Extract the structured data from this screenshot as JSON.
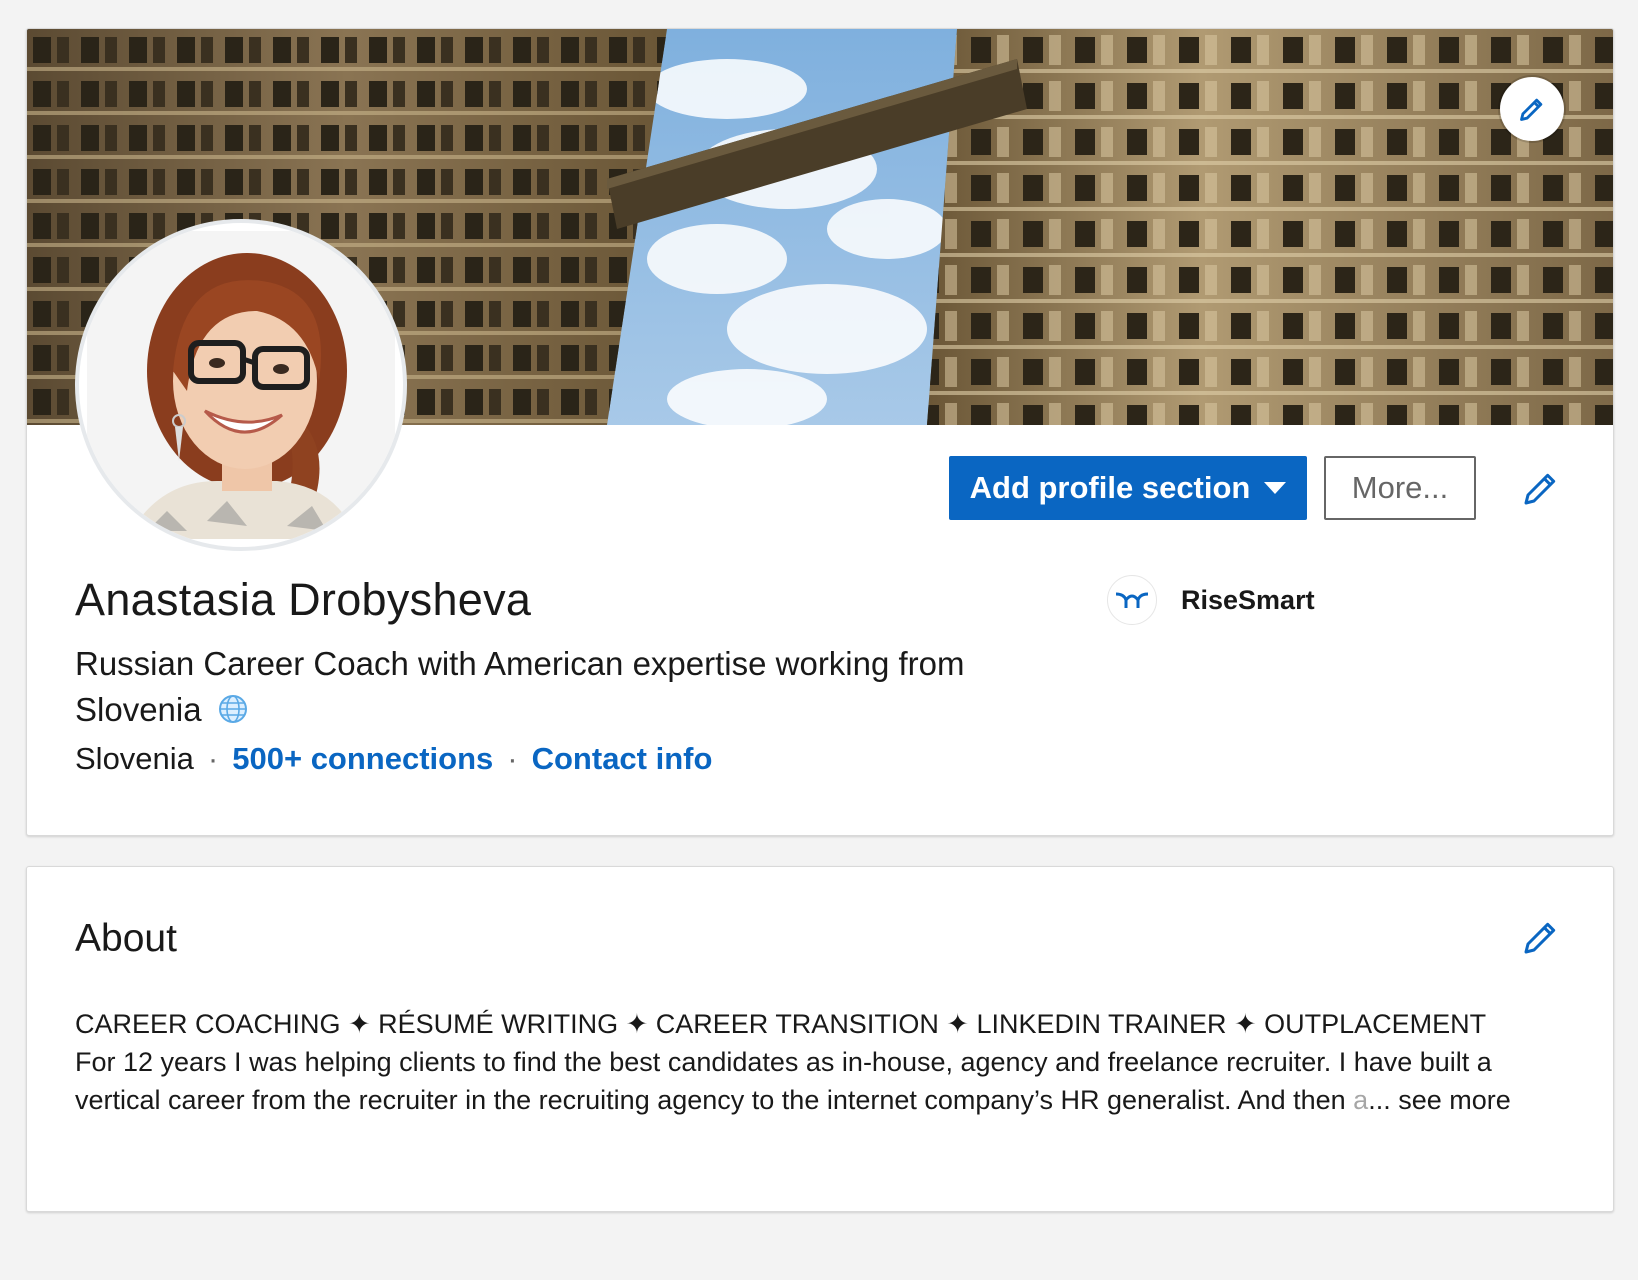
{
  "profile": {
    "name": "Anastasia Drobysheva",
    "headline": "Russian Career Coach with American expertise working from Slovenia",
    "location": "Slovenia",
    "connections": "500+ connections",
    "contact_info": "Contact info",
    "separator": "·"
  },
  "actions": {
    "add_profile_section": "Add profile section",
    "more": "More..."
  },
  "company": {
    "name": "RiseSmart",
    "logo_color": "#0a66c2"
  },
  "about": {
    "title": "About",
    "tagline": "CAREER COACHING ✦ RÉSUMÉ WRITING ✦ CAREER TRANSITION ✦ LINKEDIN TRAINER ✦ OUTPLACEMENT",
    "line1": "For 12 years I was helping clients to find the best candidates as in-house, agency and freelance recruiter. I have built a",
    "line2_visible": "vertical career from the recruiter in the recruiting agency to the internet company’s HR generalist. And then",
    "line2_faded": "a",
    "ellipsis": "...",
    "see_more": "see more"
  },
  "theme": {
    "accent": "#0a66c2",
    "page_bg": "#f3f3f3",
    "card_bg": "#ffffff"
  },
  "icons": {
    "cover_edit": "pencil-icon",
    "profile_edit": "pencil-icon",
    "about_edit": "pencil-icon",
    "headline_badge": "globe-icon",
    "dropdown": "caret-down-icon"
  }
}
